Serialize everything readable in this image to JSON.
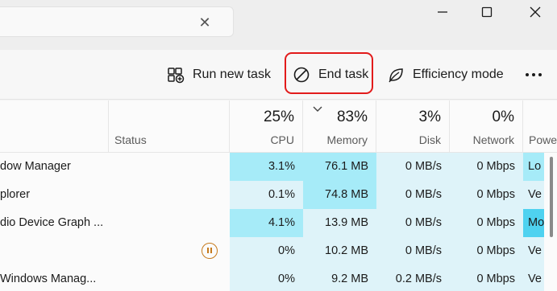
{
  "search": {
    "clear_icon": "close-icon"
  },
  "window_controls": {
    "minimize_icon": "minimize-icon",
    "maximize_icon": "maximize-icon",
    "close_icon": "close-icon"
  },
  "toolbar": {
    "run_new_task": "Run new task",
    "end_task": "End task",
    "efficiency_mode": "Efficiency mode",
    "more_icon": "more-options-icon",
    "highlight_color": "#e21b1b"
  },
  "columns": {
    "status": {
      "label": "Status"
    },
    "cpu": {
      "pct": "25%",
      "label": "CPU"
    },
    "memory": {
      "pct": "83%",
      "label": "Memory"
    },
    "disk": {
      "pct": "3%",
      "label": "Disk"
    },
    "network": {
      "pct": "0%",
      "label": "Network"
    },
    "power": {
      "label": "Powe"
    }
  },
  "rows": [
    {
      "name": "dow Manager",
      "status": "",
      "cpu": "3.1%",
      "memory": "76.1 MB",
      "disk": "0 MB/s",
      "network": "0 Mbps",
      "power": "Lo"
    },
    {
      "name": "plorer",
      "status": "",
      "cpu": "0.1%",
      "memory": "74.8 MB",
      "disk": "0 MB/s",
      "network": "0 Mbps",
      "power": "Ve"
    },
    {
      "name": "dio Device Graph ...",
      "status": "",
      "cpu": "4.1%",
      "memory": "13.9 MB",
      "disk": "0 MB/s",
      "network": "0 Mbps",
      "power": "Mo"
    },
    {
      "name": "",
      "status": "suspended",
      "cpu": "0%",
      "memory": "10.2 MB",
      "disk": "0 MB/s",
      "network": "0 Mbps",
      "power": "Ve"
    },
    {
      "name": " Windows Manag...",
      "status": "",
      "cpu": "0%",
      "memory": "9.2 MB",
      "disk": "0.2 MB/s",
      "network": "0 Mbps",
      "power": "Ve"
    }
  ],
  "heat_colors": {
    "light": "#def3f9",
    "strong": "#a6ebf8",
    "power_strong": "#4fd2f0"
  }
}
